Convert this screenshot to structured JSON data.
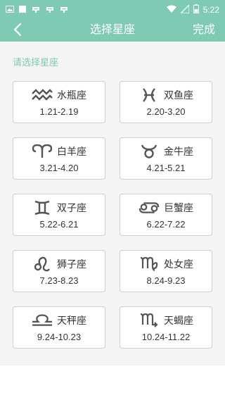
{
  "status_bar": {
    "time": "5:22"
  },
  "header": {
    "title": "选择星座",
    "done_label": "完成"
  },
  "prompt": "请选择星座",
  "colors": {
    "accent": "#7ecab3",
    "icon": "#555555",
    "border": "#cfcfcf",
    "background": "#f4f4f4"
  },
  "zodiac": [
    {
      "name": "水瓶座",
      "dates": "1.21-2.19",
      "icon": "aquarius-icon"
    },
    {
      "name": "双鱼座",
      "dates": "2.20-3.20",
      "icon": "pisces-icon"
    },
    {
      "name": "白羊座",
      "dates": "3.21-4.20",
      "icon": "aries-icon"
    },
    {
      "name": "金牛座",
      "dates": "4.21-5.21",
      "icon": "taurus-icon"
    },
    {
      "name": "双子座",
      "dates": "5.22-6.21",
      "icon": "gemini-icon"
    },
    {
      "name": "巨蟹座",
      "dates": "6.22-7.22",
      "icon": "cancer-icon"
    },
    {
      "name": "狮子座",
      "dates": "7.23-8.23",
      "icon": "leo-icon"
    },
    {
      "name": "处女座",
      "dates": "8.24-9.23",
      "icon": "virgo-icon"
    },
    {
      "name": "天秤座",
      "dates": "9.24-10.23",
      "icon": "libra-icon"
    },
    {
      "name": "天蝎座",
      "dates": "10.24-11.22",
      "icon": "scorpio-icon"
    }
  ]
}
